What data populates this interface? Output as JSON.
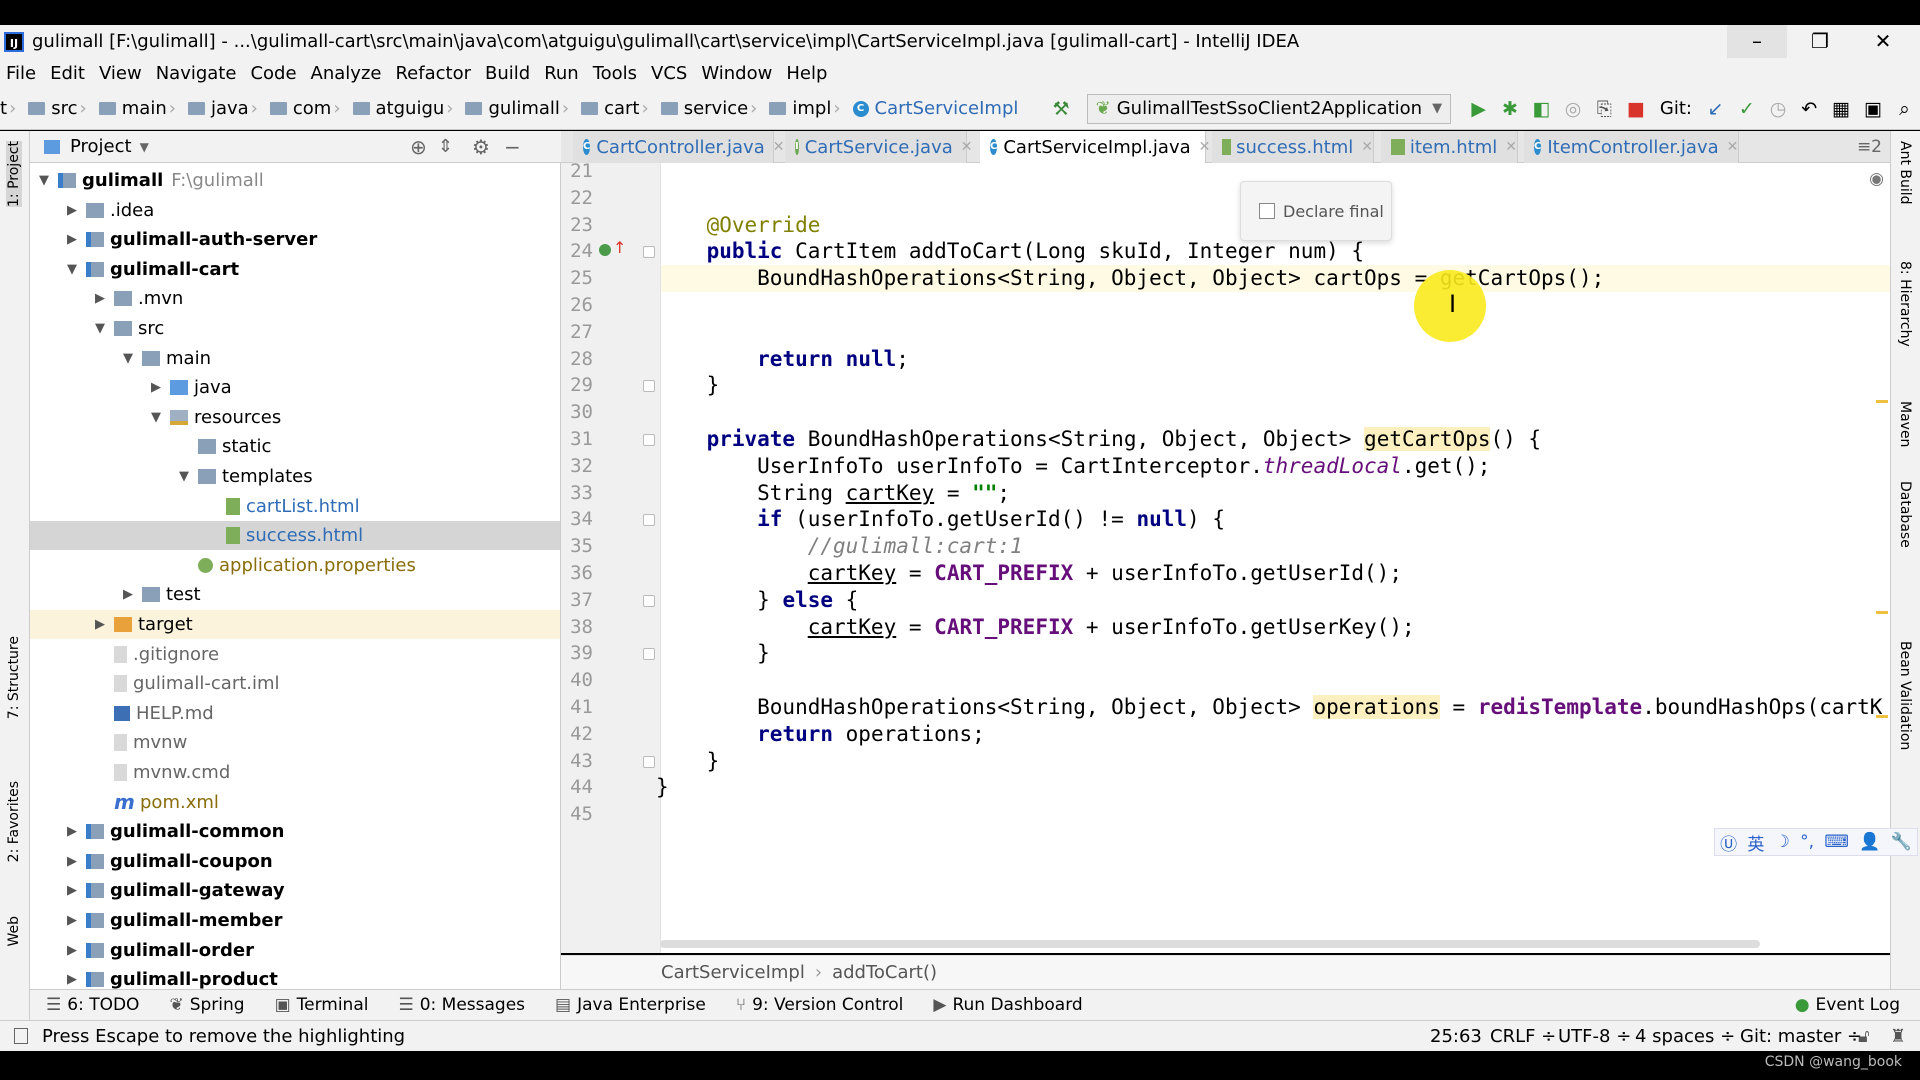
{
  "window": {
    "title": "gulimall [F:\\gulimall] - ...\\gulimall-cart\\src\\main\\java\\com\\atguigu\\gulimall\\cart\\service\\impl\\CartServiceImpl.java [gulimall-cart] - IntelliJ IDEA",
    "app_icon": "IJ",
    "minimize": "–",
    "restore": "❐",
    "close": "✕"
  },
  "menu": [
    "File",
    "Edit",
    "View",
    "Navigate",
    "Code",
    "Analyze",
    "Refactor",
    "Build",
    "Run",
    "Tools",
    "VCS",
    "Window",
    "Help"
  ],
  "nav": {
    "crumbs": [
      "t",
      "src",
      "main",
      "java",
      "com",
      "atguigu",
      "gulimall",
      "cart",
      "service",
      "impl"
    ],
    "current": "CartServiceImpl",
    "run_config": "GulimallTestSsoClient2Application",
    "git_label": "Git:"
  },
  "left_stripe": {
    "project": "1: Project",
    "structure": "7: Structure",
    "favorites": "2: Favorites",
    "web": "Web"
  },
  "right_stripe": [
    "Ant Build",
    "8: Hierarchy",
    "Maven",
    "Database",
    "Bean Validation"
  ],
  "project": {
    "title": "Project",
    "tree": [
      {
        "label": "gulimall",
        "level": 0,
        "arrow": "down",
        "icon": "module",
        "bold": true,
        "extra": "F:\\gulimall"
      },
      {
        "label": ".idea",
        "level": 1,
        "arrow": "right",
        "icon": "folder"
      },
      {
        "label": "gulimall-auth-server",
        "level": 1,
        "arrow": "right",
        "icon": "module",
        "bold": true
      },
      {
        "label": "gulimall-cart",
        "level": 1,
        "arrow": "down",
        "icon": "module",
        "bold": true
      },
      {
        "label": ".mvn",
        "level": 2,
        "arrow": "right",
        "icon": "folder"
      },
      {
        "label": "src",
        "level": 2,
        "arrow": "down",
        "icon": "folder"
      },
      {
        "label": "main",
        "level": 3,
        "arrow": "down",
        "icon": "folder"
      },
      {
        "label": "java",
        "level": 4,
        "arrow": "right",
        "icon": "src"
      },
      {
        "label": "resources",
        "level": 4,
        "arrow": "down",
        "icon": "res"
      },
      {
        "label": "static",
        "level": 5,
        "arrow": "",
        "icon": "folder"
      },
      {
        "label": "templates",
        "level": 5,
        "arrow": "down",
        "icon": "folder"
      },
      {
        "label": "cartList.html",
        "level": 6,
        "arrow": "",
        "icon": "html",
        "color": "#2f6cb5"
      },
      {
        "label": "success.html",
        "level": 6,
        "arrow": "",
        "icon": "html",
        "color": "#2f6cb5",
        "selected": true
      },
      {
        "label": "application.properties",
        "level": 5,
        "arrow": "",
        "icon": "prop",
        "color": "#8a6d0b",
        "shift": -1
      },
      {
        "label": "test",
        "level": 3,
        "arrow": "right",
        "icon": "folder"
      },
      {
        "label": "target",
        "level": 2,
        "arrow": "right",
        "icon": "orange",
        "highlight": true
      },
      {
        "label": ".gitignore",
        "level": 2,
        "arrow": "",
        "icon": "file",
        "color": "#666"
      },
      {
        "label": "gulimall-cart.iml",
        "level": 2,
        "arrow": "",
        "icon": "file",
        "color": "#666"
      },
      {
        "label": "HELP.md",
        "level": 2,
        "arrow": "",
        "icon": "md",
        "color": "#666"
      },
      {
        "label": "mvnw",
        "level": 2,
        "arrow": "",
        "icon": "file",
        "color": "#666"
      },
      {
        "label": "mvnw.cmd",
        "level": 2,
        "arrow": "",
        "icon": "file",
        "color": "#666"
      },
      {
        "label": "pom.xml",
        "level": 2,
        "arrow": "",
        "icon": "xml",
        "color": "#8a6d0b",
        "xml_glyph": "m"
      },
      {
        "label": "gulimall-common",
        "level": 1,
        "arrow": "right",
        "icon": "module",
        "bold": true
      },
      {
        "label": "gulimall-coupon",
        "level": 1,
        "arrow": "right",
        "icon": "module",
        "bold": true
      },
      {
        "label": "gulimall-gateway",
        "level": 1,
        "arrow": "right",
        "icon": "module",
        "bold": true
      },
      {
        "label": "gulimall-member",
        "level": 1,
        "arrow": "right",
        "icon": "module",
        "bold": true
      },
      {
        "label": "gulimall-order",
        "level": 1,
        "arrow": "right",
        "icon": "module",
        "bold": true
      },
      {
        "label": "gulimall-product",
        "level": 1,
        "arrow": "right",
        "icon": "module",
        "bold": true
      }
    ]
  },
  "tabs": [
    {
      "label": "CartController.java",
      "icon": "class"
    },
    {
      "label": "CartService.java",
      "icon": "interface"
    },
    {
      "label": "CartServiceImpl.java",
      "icon": "class",
      "active": true
    },
    {
      "label": "success.html",
      "icon": "html"
    },
    {
      "label": "item.html",
      "icon": "html"
    },
    {
      "label": "ItemController.java",
      "icon": "class"
    }
  ],
  "tabs_overflow": "≡2",
  "popup": {
    "label": "Declare final",
    "checked": false
  },
  "editor": {
    "first_line": 21,
    "current_line": 25,
    "fold_lines": [
      24,
      29,
      31,
      34,
      37,
      39,
      43
    ],
    "lines": [
      [],
      [],
      [
        [
          "    ",
          ""
        ],
        [
          "@Override",
          "ann"
        ]
      ],
      [
        [
          "    ",
          ""
        ],
        [
          "public",
          "kw"
        ],
        [
          " CartItem addToCart(Long skuId, Integer num) {",
          ""
        ]
      ],
      [
        [
          "        BoundHashOperations<String, Object, Object> cartOps = getCartOps();",
          ""
        ]
      ],
      [],
      [],
      [
        [
          "        ",
          ""
        ],
        [
          "return",
          "kw"
        ],
        [
          " ",
          ""
        ],
        [
          "null",
          "kw"
        ],
        [
          ";",
          ""
        ]
      ],
      [
        [
          "    }",
          ""
        ]
      ],
      [],
      [
        [
          "    ",
          ""
        ],
        [
          "private",
          "kw"
        ],
        [
          " BoundHashOperations<String, Object, Object> ",
          ""
        ],
        [
          "getCartOps",
          "hlm"
        ],
        [
          "() {",
          ""
        ]
      ],
      [
        [
          "        UserInfoTo userInfoTo = CartInterceptor.",
          ""
        ],
        [
          "threadLocal",
          "ital"
        ],
        [
          ".get();",
          ""
        ]
      ],
      [
        [
          "        String ",
          ""
        ],
        [
          "cartKey",
          "ul"
        ],
        [
          " = ",
          ""
        ],
        [
          "\"\"",
          "str"
        ],
        [
          ";",
          ""
        ]
      ],
      [
        [
          "        ",
          ""
        ],
        [
          "if",
          "kw"
        ],
        [
          " (userInfoTo.getUserId() != ",
          ""
        ],
        [
          "null",
          "kw"
        ],
        [
          ") {",
          ""
        ]
      ],
      [
        [
          "            ",
          ""
        ],
        [
          "//gulimall:cart:1",
          "cmt"
        ]
      ],
      [
        [
          "            ",
          ""
        ],
        [
          "cartKey",
          "ul"
        ],
        [
          " = ",
          ""
        ],
        [
          "CART_PREFIX",
          "fld"
        ],
        [
          " + userInfoTo.getUserId();",
          ""
        ]
      ],
      [
        [
          "        } ",
          ""
        ],
        [
          "else",
          "kw"
        ],
        [
          " {",
          ""
        ]
      ],
      [
        [
          "            ",
          ""
        ],
        [
          "cartKey",
          "ul"
        ],
        [
          " = ",
          ""
        ],
        [
          "CART_PREFIX",
          "fld"
        ],
        [
          " + userInfoTo.getUserKey();",
          ""
        ]
      ],
      [
        [
          "        }",
          ""
        ]
      ],
      [],
      [
        [
          "        BoundHashOperations<String, Object, Object> ",
          ""
        ],
        [
          "operations",
          "hlm"
        ],
        [
          " = ",
          ""
        ],
        [
          "redisTemplate",
          "fld"
        ],
        [
          ".boundHashOps(cartK",
          ""
        ]
      ],
      [
        [
          "        ",
          ""
        ],
        [
          "return",
          "kw"
        ],
        [
          " operations;",
          ""
        ]
      ],
      [
        [
          "    }",
          ""
        ]
      ],
      [
        [
          "}",
          ""
        ]
      ],
      []
    ]
  },
  "breadcrumb": [
    "CartServiceImpl",
    "addToCart()"
  ],
  "tool_windows": [
    {
      "label": "6: TODO",
      "icon": "☰"
    },
    {
      "label": "Spring",
      "icon": "❦"
    },
    {
      "label": "Terminal",
      "icon": "▣"
    },
    {
      "label": "0: Messages",
      "icon": "☰"
    },
    {
      "label": "Java Enterprise",
      "icon": "▤"
    },
    {
      "label": "9: Version Control",
      "icon": "⑂"
    },
    {
      "label": "Run Dashboard",
      "icon": "▶"
    }
  ],
  "event_log": "Event Log",
  "status": {
    "message": "Press Escape to remove the highlighting",
    "position": "25:63",
    "line_sep": "CRLF ÷",
    "encoding": "UTF-8 ÷",
    "indent": "4 spaces ÷",
    "git": "Git: master ÷"
  },
  "ime": [
    "Ⓤ",
    "英",
    "☽",
    "°,",
    "⌨",
    "👤",
    "🔧"
  ],
  "watermark": "CSDN @wang_book"
}
